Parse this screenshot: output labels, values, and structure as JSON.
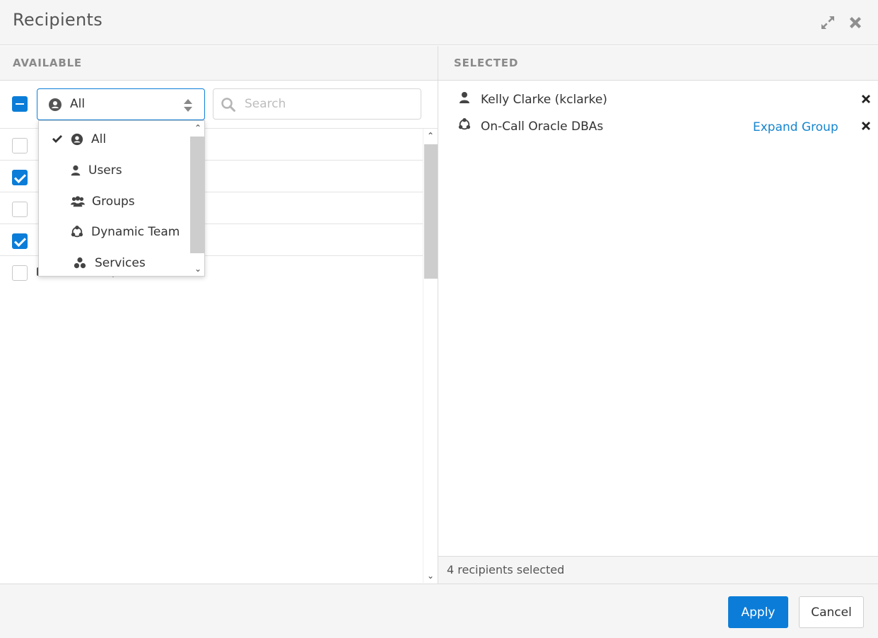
{
  "dialog": {
    "title": "Recipients",
    "header_icons": [
      "expand-icon",
      "close-icon"
    ]
  },
  "available": {
    "heading": "AVAILABLE",
    "master_checkbox_state": "indeterminate",
    "filter": {
      "selected": "All",
      "icon": "user-circle-icon"
    },
    "search": {
      "placeholder": "Search",
      "value": ""
    },
    "rows": [
      {
        "checked": false,
        "label": ""
      },
      {
        "checked": true,
        "label": ""
      },
      {
        "checked": false,
        "label": ""
      },
      {
        "checked": true,
        "label": ""
      },
      {
        "checked": false,
        "label": "bredGroup"
      }
    ]
  },
  "filter_dropdown": {
    "options": [
      {
        "label": "All",
        "icon": "user-circle-icon",
        "selected": true
      },
      {
        "label": "Users",
        "icon": "user-icon",
        "selected": false
      },
      {
        "label": "Groups",
        "icon": "users-icon",
        "selected": false
      },
      {
        "label": "Dynamic Team",
        "icon": "dynamic-team-icon",
        "selected": false
      },
      {
        "label": "Services",
        "icon": "services-icon",
        "selected": false
      }
    ]
  },
  "selected": {
    "heading": "SELECTED",
    "items": [
      {
        "label": "Kelly Clarke (kclarke)",
        "icon": "user-icon",
        "action": ""
      },
      {
        "label": "On-Call Oracle DBAs",
        "icon": "dynamic-team-icon",
        "action": "Expand Group"
      }
    ],
    "count_text": "4 recipients selected"
  },
  "footer": {
    "apply_label": "Apply",
    "cancel_label": "Cancel"
  },
  "colors": {
    "accent": "#0b7dd8",
    "link": "#1585cf",
    "panel_bg": "#f5f5f5"
  }
}
